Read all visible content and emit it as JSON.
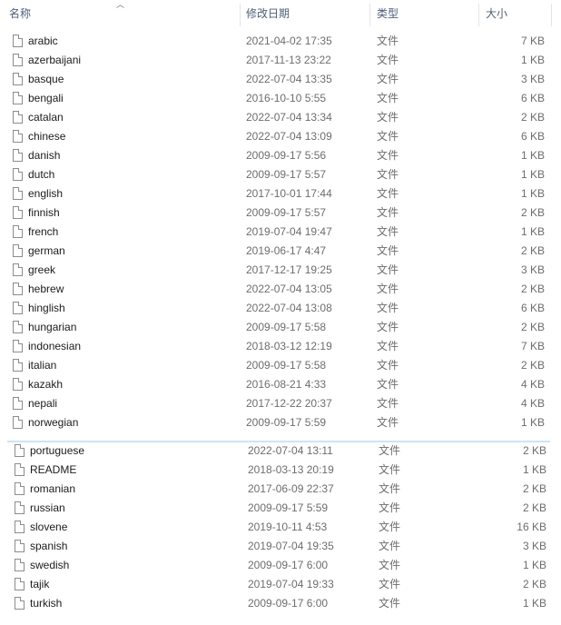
{
  "header": {
    "name_label": "名称",
    "date_label": "修改日期",
    "type_label": "类型",
    "size_label": "大小",
    "sort_icon": "sort-ascending-icon"
  },
  "group1": [
    {
      "name": "arabic",
      "date": "2021-04-02 17:35",
      "type": "文件",
      "size": "7 KB"
    },
    {
      "name": "azerbaijani",
      "date": "2017-11-13 23:22",
      "type": "文件",
      "size": "1 KB"
    },
    {
      "name": "basque",
      "date": "2022-07-04 13:35",
      "type": "文件",
      "size": "3 KB"
    },
    {
      "name": "bengali",
      "date": "2016-10-10 5:55",
      "type": "文件",
      "size": "6 KB"
    },
    {
      "name": "catalan",
      "date": "2022-07-04 13:34",
      "type": "文件",
      "size": "2 KB"
    },
    {
      "name": "chinese",
      "date": "2022-07-04 13:09",
      "type": "文件",
      "size": "6 KB"
    },
    {
      "name": "danish",
      "date": "2009-09-17 5:56",
      "type": "文件",
      "size": "1 KB"
    },
    {
      "name": "dutch",
      "date": "2009-09-17 5:57",
      "type": "文件",
      "size": "1 KB"
    },
    {
      "name": "english",
      "date": "2017-10-01 17:44",
      "type": "文件",
      "size": "1 KB"
    },
    {
      "name": "finnish",
      "date": "2009-09-17 5:57",
      "type": "文件",
      "size": "2 KB"
    },
    {
      "name": "french",
      "date": "2019-07-04 19:47",
      "type": "文件",
      "size": "1 KB"
    },
    {
      "name": "german",
      "date": "2019-06-17 4:47",
      "type": "文件",
      "size": "2 KB"
    },
    {
      "name": "greek",
      "date": "2017-12-17 19:25",
      "type": "文件",
      "size": "3 KB"
    },
    {
      "name": "hebrew",
      "date": "2022-07-04 13:05",
      "type": "文件",
      "size": "2 KB"
    },
    {
      "name": "hinglish",
      "date": "2022-07-04 13:08",
      "type": "文件",
      "size": "6 KB"
    },
    {
      "name": "hungarian",
      "date": "2009-09-17 5:58",
      "type": "文件",
      "size": "2 KB"
    },
    {
      "name": "indonesian",
      "date": "2018-03-12 12:19",
      "type": "文件",
      "size": "7 KB"
    },
    {
      "name": "italian",
      "date": "2009-09-17 5:58",
      "type": "文件",
      "size": "2 KB"
    },
    {
      "name": "kazakh",
      "date": "2016-08-21 4:33",
      "type": "文件",
      "size": "4 KB"
    },
    {
      "name": "nepali",
      "date": "2017-12-22 20:37",
      "type": "文件",
      "size": "4 KB"
    },
    {
      "name": "norwegian",
      "date": "2009-09-17 5:59",
      "type": "文件",
      "size": "1 KB"
    }
  ],
  "group2": [
    {
      "name": "portuguese",
      "date": "2022-07-04 13:11",
      "type": "文件",
      "size": "2 KB"
    },
    {
      "name": "README",
      "date": "2018-03-13 20:19",
      "type": "文件",
      "size": "1 KB"
    },
    {
      "name": "romanian",
      "date": "2017-06-09 22:37",
      "type": "文件",
      "size": "2 KB"
    },
    {
      "name": "russian",
      "date": "2009-09-17 5:59",
      "type": "文件",
      "size": "2 KB"
    },
    {
      "name": "slovene",
      "date": "2019-10-11 4:53",
      "type": "文件",
      "size": "16 KB"
    },
    {
      "name": "spanish",
      "date": "2019-07-04 19:35",
      "type": "文件",
      "size": "3 KB"
    },
    {
      "name": "swedish",
      "date": "2009-09-17 6:00",
      "type": "文件",
      "size": "1 KB"
    },
    {
      "name": "tajik",
      "date": "2019-07-04 19:33",
      "type": "文件",
      "size": "2 KB"
    },
    {
      "name": "turkish",
      "date": "2009-09-17 6:00",
      "type": "文件",
      "size": "1 KB"
    }
  ]
}
